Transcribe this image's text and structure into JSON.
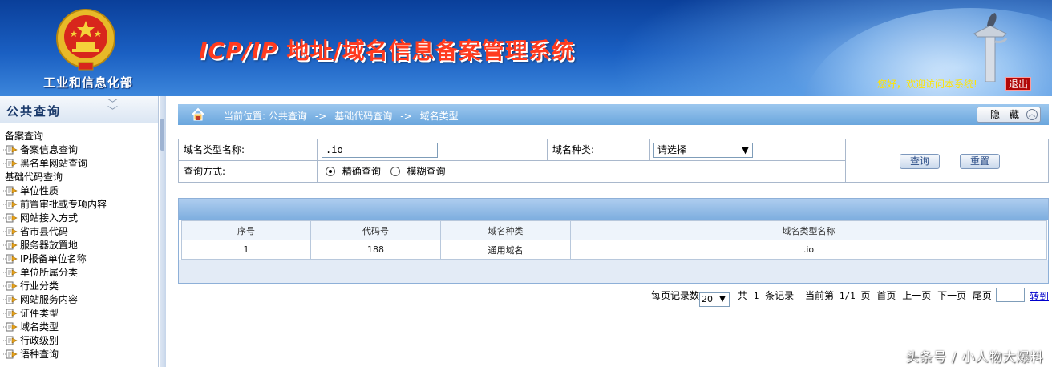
{
  "header": {
    "ministry_name": "工业和信息化部",
    "system_title_latin": "ICP/IP",
    "system_title_cn": " 地址/域名信息备案管理系统",
    "greeting": "您好，欢迎访问本系统!",
    "logout_label": "退出",
    "colors": {
      "title": "#ff3b1f",
      "greeting": "#ffe400",
      "logout_bg": "#b10808"
    }
  },
  "sidebar": {
    "title": "公共查询",
    "groups": [
      {
        "label": "备案查询",
        "items": [
          "备案信息查询",
          "黑名单网站查询"
        ]
      },
      {
        "label": "基础代码查询",
        "items": [
          "单位性质",
          "前置审批或专项内容",
          "网站接入方式",
          "省市县代码",
          "服务器放置地",
          "IP报备单位名称",
          "单位所属分类",
          "行业分类",
          "网站服务内容",
          "证件类型",
          "域名类型",
          "行政级别",
          "语种查询"
        ]
      }
    ]
  },
  "breadcrumb": {
    "prefix": "当前位置: 公共查询",
    "sep": "->",
    "level2": "基础代码查询",
    "level3": "域名类型",
    "hide_label": "隐藏"
  },
  "form": {
    "name_label": "域名类型名称:",
    "name_value": ".io",
    "kind_label": "域名种类:",
    "kind_value": "请选择",
    "mode_label": "查询方式:",
    "mode_exact": "精确查询",
    "mode_fuzzy": "模糊查询",
    "query_button": "查询",
    "reset_button": "重置"
  },
  "table": {
    "columns": [
      "序号",
      "代码号",
      "域名种类",
      "域名类型名称"
    ],
    "rows": [
      [
        "1",
        "188",
        "通用域名",
        ".io"
      ]
    ]
  },
  "pager": {
    "per_page_label": "每页记录数",
    "per_page_value": "20",
    "total_prefix": "共",
    "total_count": "1",
    "total_suffix": "条记录",
    "current_prefix": "当前第",
    "current_value": "1/1",
    "current_suffix": "页",
    "first": "首页",
    "prev": "上一页",
    "next": "下一页",
    "last": "尾页",
    "goto_label": "转到"
  },
  "watermark": "头条号 / 小人物大爆料"
}
